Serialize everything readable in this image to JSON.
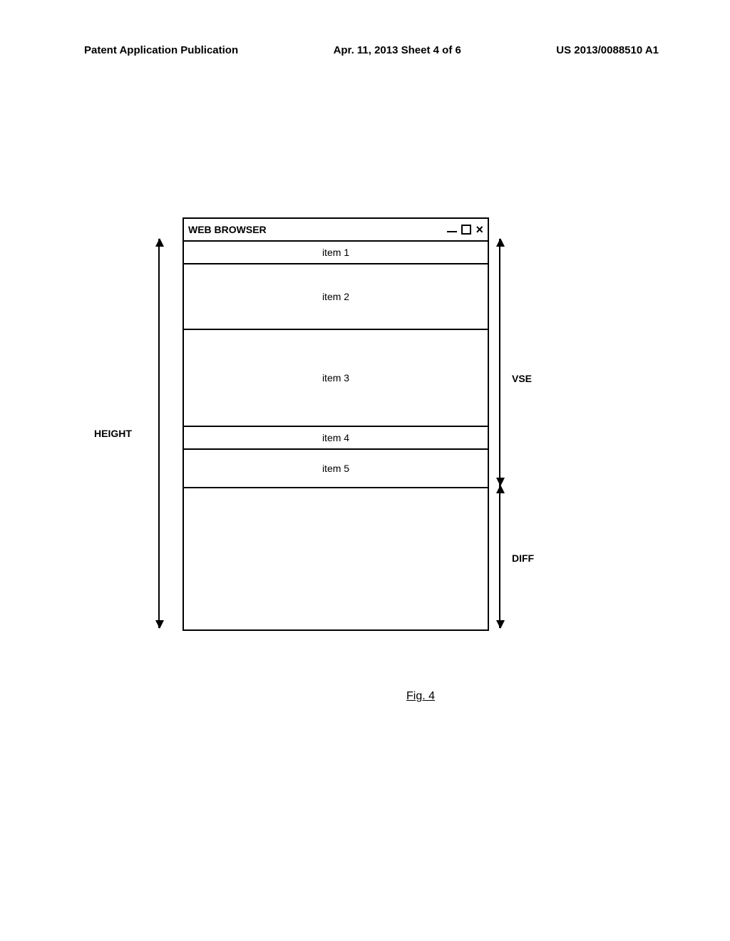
{
  "header": {
    "left": "Patent Application Publication",
    "mid": "Apr. 11, 2013  Sheet 4 of 6",
    "right": "US 2013/0088510 A1"
  },
  "window": {
    "title": "WEB BROWSER",
    "items": [
      "item 1",
      "item 2",
      "item 3",
      "item 4",
      "item 5"
    ]
  },
  "labels": {
    "height": "HEIGHT",
    "vse": "VSE",
    "diff": "DIFF"
  },
  "caption": "Fig. 4"
}
